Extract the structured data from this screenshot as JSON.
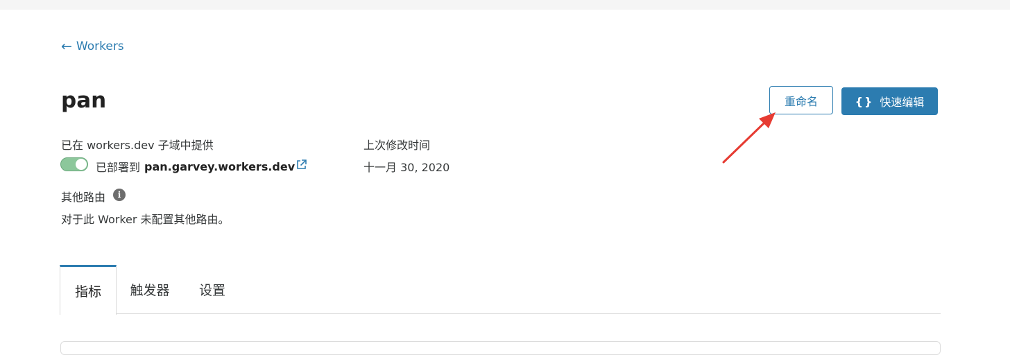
{
  "nav": {
    "back_arrow": "←",
    "back_label": "Workers"
  },
  "page": {
    "title": "pan"
  },
  "actions": {
    "rename_label": "重命名",
    "quick_edit_icon": "{}",
    "quick_edit_label": "快速编辑"
  },
  "subdomain": {
    "label": "已在 workers.dev 子域中提供",
    "status_prefix": "已部署到",
    "url": "pan.garvey.workers.dev",
    "toggle_on": true
  },
  "modified": {
    "label": "上次修改时间",
    "value": "十一月 30, 2020"
  },
  "routes": {
    "label": "其他路由",
    "info_icon": "i",
    "description": "对于此 Worker 未配置其他路由。"
  },
  "tabs": [
    {
      "label": "指标",
      "active": true
    },
    {
      "label": "触发器",
      "active": false
    },
    {
      "label": "设置",
      "active": false
    }
  ],
  "colors": {
    "accent": "#2c7cb0",
    "toggle": "#8cc79b",
    "annotation_arrow": "#e63b32"
  }
}
